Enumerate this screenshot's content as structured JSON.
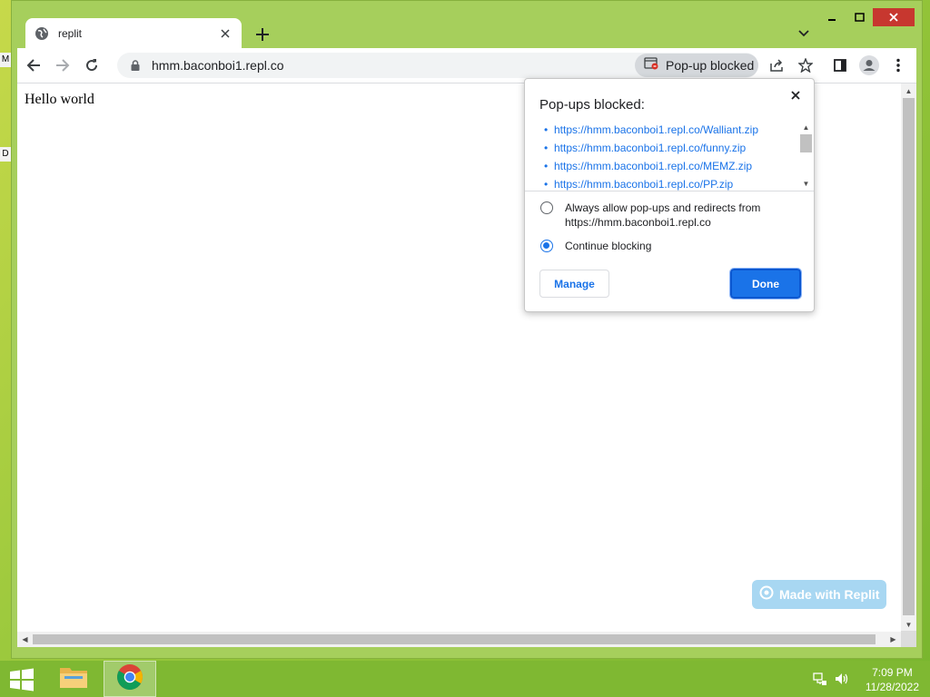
{
  "desktop": {
    "glyph_top": "M",
    "glyph_bottom": "D"
  },
  "tab": {
    "title": "replit",
    "icon": "globe-icon"
  },
  "toolbar": {
    "url": "hmm.baconboi1.repl.co",
    "popup_chip_label": "Pop-up blocked"
  },
  "page": {
    "content": "Hello world",
    "badge_label": "Made with Replit"
  },
  "bubble": {
    "title": "Pop-ups blocked:",
    "blocked": [
      "https://hmm.baconboi1.repl.co/Walliant.zip",
      "https://hmm.baconboi1.repl.co/funny.zip",
      "https://hmm.baconboi1.repl.co/MEMZ.zip",
      "https://hmm.baconboi1.repl.co/PP.zip"
    ],
    "option_allow": "Always allow pop-ups and redirects from https://hmm.baconboi1.repl.co",
    "option_block": "Continue blocking",
    "selected_option": "Continue blocking",
    "manage_label": "Manage",
    "done_label": "Done"
  },
  "taskbar": {
    "time": "7:09 PM",
    "date": "11/28/2022"
  },
  "colors": {
    "accent": "#1a73e8",
    "taskbar": "#7fb832",
    "window_frame": "#a6cf5c"
  }
}
